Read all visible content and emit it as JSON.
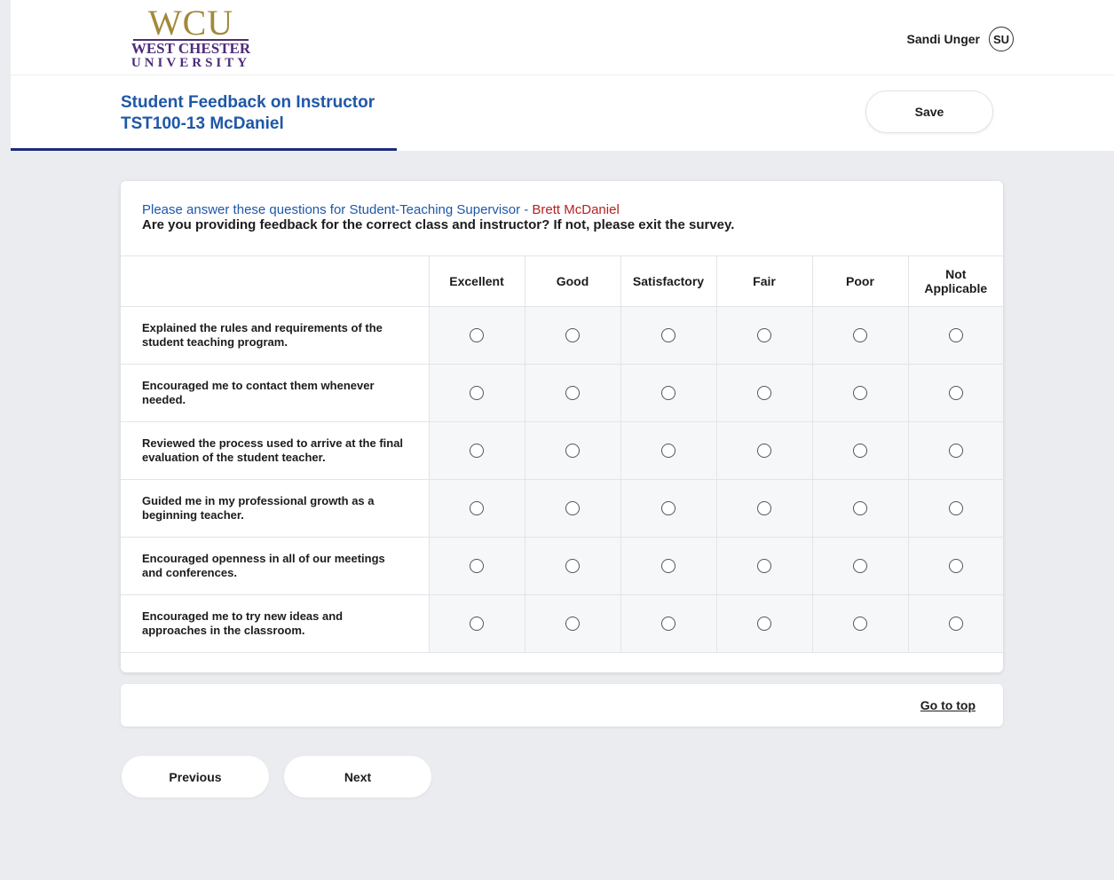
{
  "logo": {
    "wcu": "WCU",
    "line1": "WEST CHESTER",
    "line2": "UNIVERSITY"
  },
  "user": {
    "name": "Sandi Unger",
    "initials": "SU"
  },
  "header": {
    "title_line1": "Student Feedback on Instructor",
    "title_line2": "TST100-13 McDaniel",
    "save_label": "Save"
  },
  "survey": {
    "prompt_prefix": "Please answer these questions for Student-Teaching Supervisor - ",
    "instructor_name": "Brett McDaniel",
    "subprompt": "Are you providing feedback for the correct class and instructor? If not, please exit the survey.",
    "columns": [
      "Excellent",
      "Good",
      "Satisfactory",
      "Fair",
      "Poor",
      "Not Applicable"
    ],
    "questions": [
      "Explained the rules and requirements of the student teaching program.",
      "Encouraged me to contact them whenever needed.",
      "Reviewed the process used to arrive at the final evaluation of the student teacher.",
      "Guided me in my professional growth as a beginning teacher.",
      "Encouraged openness in all of our meetings and conferences.",
      "Encouraged me to try new ideas and approaches in the classroom."
    ]
  },
  "footer": {
    "go_to_top": "Go to top"
  },
  "nav": {
    "previous": "Previous",
    "next": "Next"
  },
  "colors": {
    "title_blue": "#1f57a8",
    "instructor_red": "#b22222",
    "tab_underline": "#1c2d7a",
    "logo_purple": "#4c2c7a",
    "logo_gold": "#a08a3b"
  }
}
